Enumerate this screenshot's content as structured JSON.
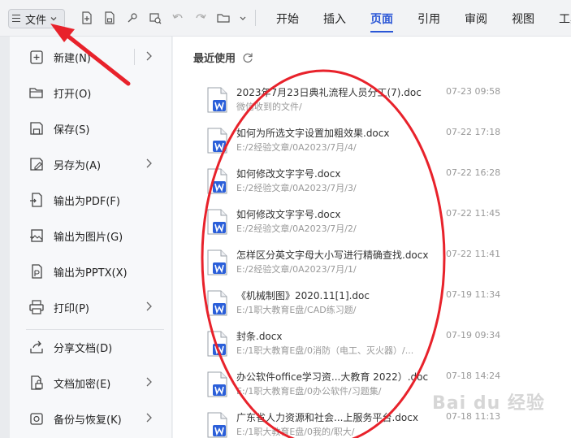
{
  "toolbar": {
    "file_label": "文件",
    "tabs": [
      {
        "label": "开始"
      },
      {
        "label": "插入"
      },
      {
        "label": "页面"
      },
      {
        "label": "引用"
      },
      {
        "label": "审阅"
      },
      {
        "label": "视图"
      },
      {
        "label": "工具"
      }
    ],
    "active_tab": "页面"
  },
  "menu": {
    "items": [
      {
        "label": "新建(N)",
        "icon": "new-doc-icon",
        "submenu": true
      },
      {
        "label": "打开(O)",
        "icon": "folder-open-icon",
        "submenu": false
      },
      {
        "label": "保存(S)",
        "icon": "save-icon",
        "submenu": false
      },
      {
        "label": "另存为(A)",
        "icon": "save-as-icon",
        "submenu": true
      },
      {
        "label": "输出为PDF(F)",
        "icon": "export-pdf-icon",
        "submenu": false
      },
      {
        "label": "输出为图片(G)",
        "icon": "export-image-icon",
        "submenu": false
      },
      {
        "label": "输出为PPTX(X)",
        "icon": "export-pptx-icon",
        "submenu": false
      },
      {
        "label": "打印(P)",
        "icon": "print-icon",
        "submenu": true
      },
      {
        "label": "分享文档(D)",
        "icon": "share-icon",
        "submenu": false
      },
      {
        "label": "文档加密(E)",
        "icon": "encrypt-icon",
        "submenu": true
      },
      {
        "label": "备份与恢复(K)",
        "icon": "backup-icon",
        "submenu": true
      }
    ]
  },
  "recent": {
    "title": "最近使用",
    "files": [
      {
        "name": "2023年7月23日典礼流程人员分工(7).doc",
        "path": "微信收到的文件/",
        "date": "07-23 09:58"
      },
      {
        "name": "如何为所选文字设置加粗效果.docx",
        "path": "E:/2经验文章/0A2023/7月/4/",
        "date": "07-22 17:18"
      },
      {
        "name": "如何修改文字字号.docx",
        "path": "E:/2经验文章/0A2023/7月/3/",
        "date": "07-22 16:28"
      },
      {
        "name": "如何修改文字字号.docx",
        "path": "E:/2经验文章/0A2023/7月/2/",
        "date": "07-22 11:45"
      },
      {
        "name": "怎样区分英文字母大小写进行精确查找.docx",
        "path": "E:/2经验文章/0A2023/7月/1/",
        "date": "07-22 11:41"
      },
      {
        "name": "《机械制图》2020.11[1].doc",
        "path": "E:/1职大教育E盘/CAD练习题/",
        "date": "07-19 11:34"
      },
      {
        "name": "封条.docx",
        "path": "E:/1职大教育E盘/0消防（电工、灭火器）/...",
        "date": "07-19 09:34"
      },
      {
        "name": "办公软件office学习资...大教育 2022）.doc",
        "path": "E:/1职大教育E盘/0办公软件/习题集/",
        "date": "07-18 14:24"
      },
      {
        "name": "广东省人力资源和社会...上服务平台.docx",
        "path": "E:/1职大教育E盘/0我的/职大/",
        "date": "07-18 11:13"
      }
    ]
  },
  "watermark": "Bai du 经验",
  "colors": {
    "accent": "#2a56d6",
    "annotation": "#e8222b",
    "word_blue": "#2b5fd9"
  }
}
